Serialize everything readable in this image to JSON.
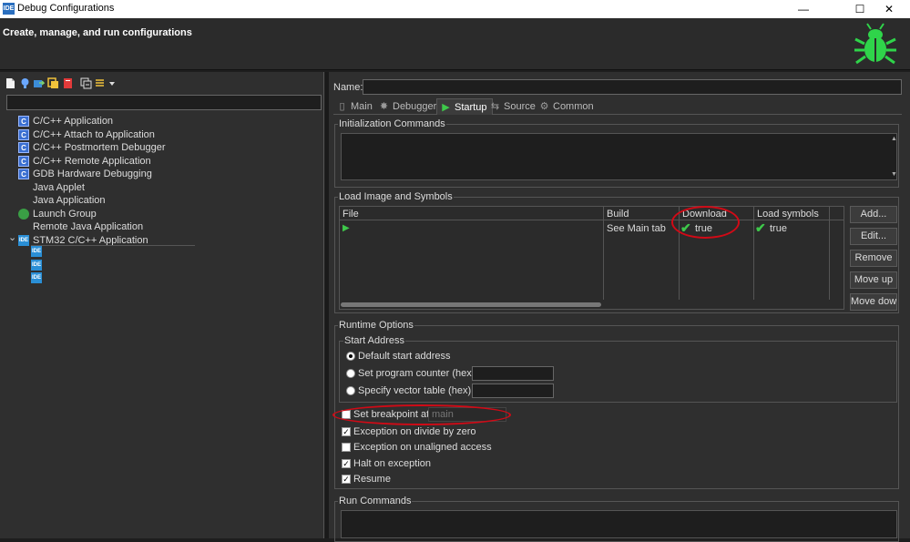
{
  "window": {
    "title": "Debug Configurations",
    "app_icon": "IDE",
    "minimize": "—",
    "maximize": "☐",
    "close": "✕"
  },
  "header": {
    "title": "Create, manage, and run configurations"
  },
  "tree": {
    "items": [
      {
        "label": "C/C++ Application",
        "icon": "C"
      },
      {
        "label": "C/C++ Attach to Application",
        "icon": "C"
      },
      {
        "label": "C/C++ Postmortem Debugger",
        "icon": "C"
      },
      {
        "label": "C/C++ Remote Application",
        "icon": "C"
      },
      {
        "label": "GDB Hardware Debugging",
        "icon": "C"
      },
      {
        "label": "Java Applet",
        "icon": ""
      },
      {
        "label": "Java Application",
        "icon": ""
      },
      {
        "label": "Launch Group",
        "icon": "lg"
      },
      {
        "label": "Remote Java Application",
        "icon": ""
      },
      {
        "label": "STM32 C/C++ Application",
        "icon": "IDE",
        "expanded": true
      }
    ],
    "children_icon": "IDE",
    "expand_glyph": "⌄"
  },
  "config": {
    "name_label": "Name:",
    "name_value": "",
    "tabs": [
      {
        "label": "Main",
        "icon": "▯"
      },
      {
        "label": "Debugger",
        "icon": "✸"
      },
      {
        "label": "Startup",
        "icon": "▶",
        "active": true
      },
      {
        "label": "Source",
        "icon": "⇆"
      },
      {
        "label": "Common",
        "icon": "⚙"
      }
    ],
    "init_commands_legend": "Initialization Commands",
    "load_legend": "Load Image and Symbols",
    "load_table": {
      "headers": [
        "File",
        "Build",
        "Download",
        "Load symbols"
      ],
      "row": {
        "file": "",
        "build": "See Main tab",
        "download": "true",
        "symbols": "true"
      }
    },
    "buttons": [
      "Add...",
      "Edit...",
      "Remove",
      "Move up",
      "Move down"
    ],
    "runtime_legend": "Runtime Options",
    "start_address_legend": "Start Address",
    "radios": [
      {
        "label": "Default start address",
        "selected": true
      },
      {
        "label": "Set program counter (hex):",
        "selected": false
      },
      {
        "label": "Specify vector table (hex):",
        "selected": false
      }
    ],
    "breakpoint_label": "Set breakpoint at:",
    "breakpoint_placeholder": "main",
    "checks": [
      {
        "label": "Exception on divide by zero",
        "checked": true
      },
      {
        "label": "Exception on unaligned access",
        "checked": false
      },
      {
        "label": "Halt on exception",
        "checked": true
      },
      {
        "label": "Resume",
        "checked": true
      }
    ],
    "run_commands_legend": "Run Commands"
  },
  "colors": {
    "accent_green": "#2fd44a",
    "annotation_red": "#d10a16"
  }
}
